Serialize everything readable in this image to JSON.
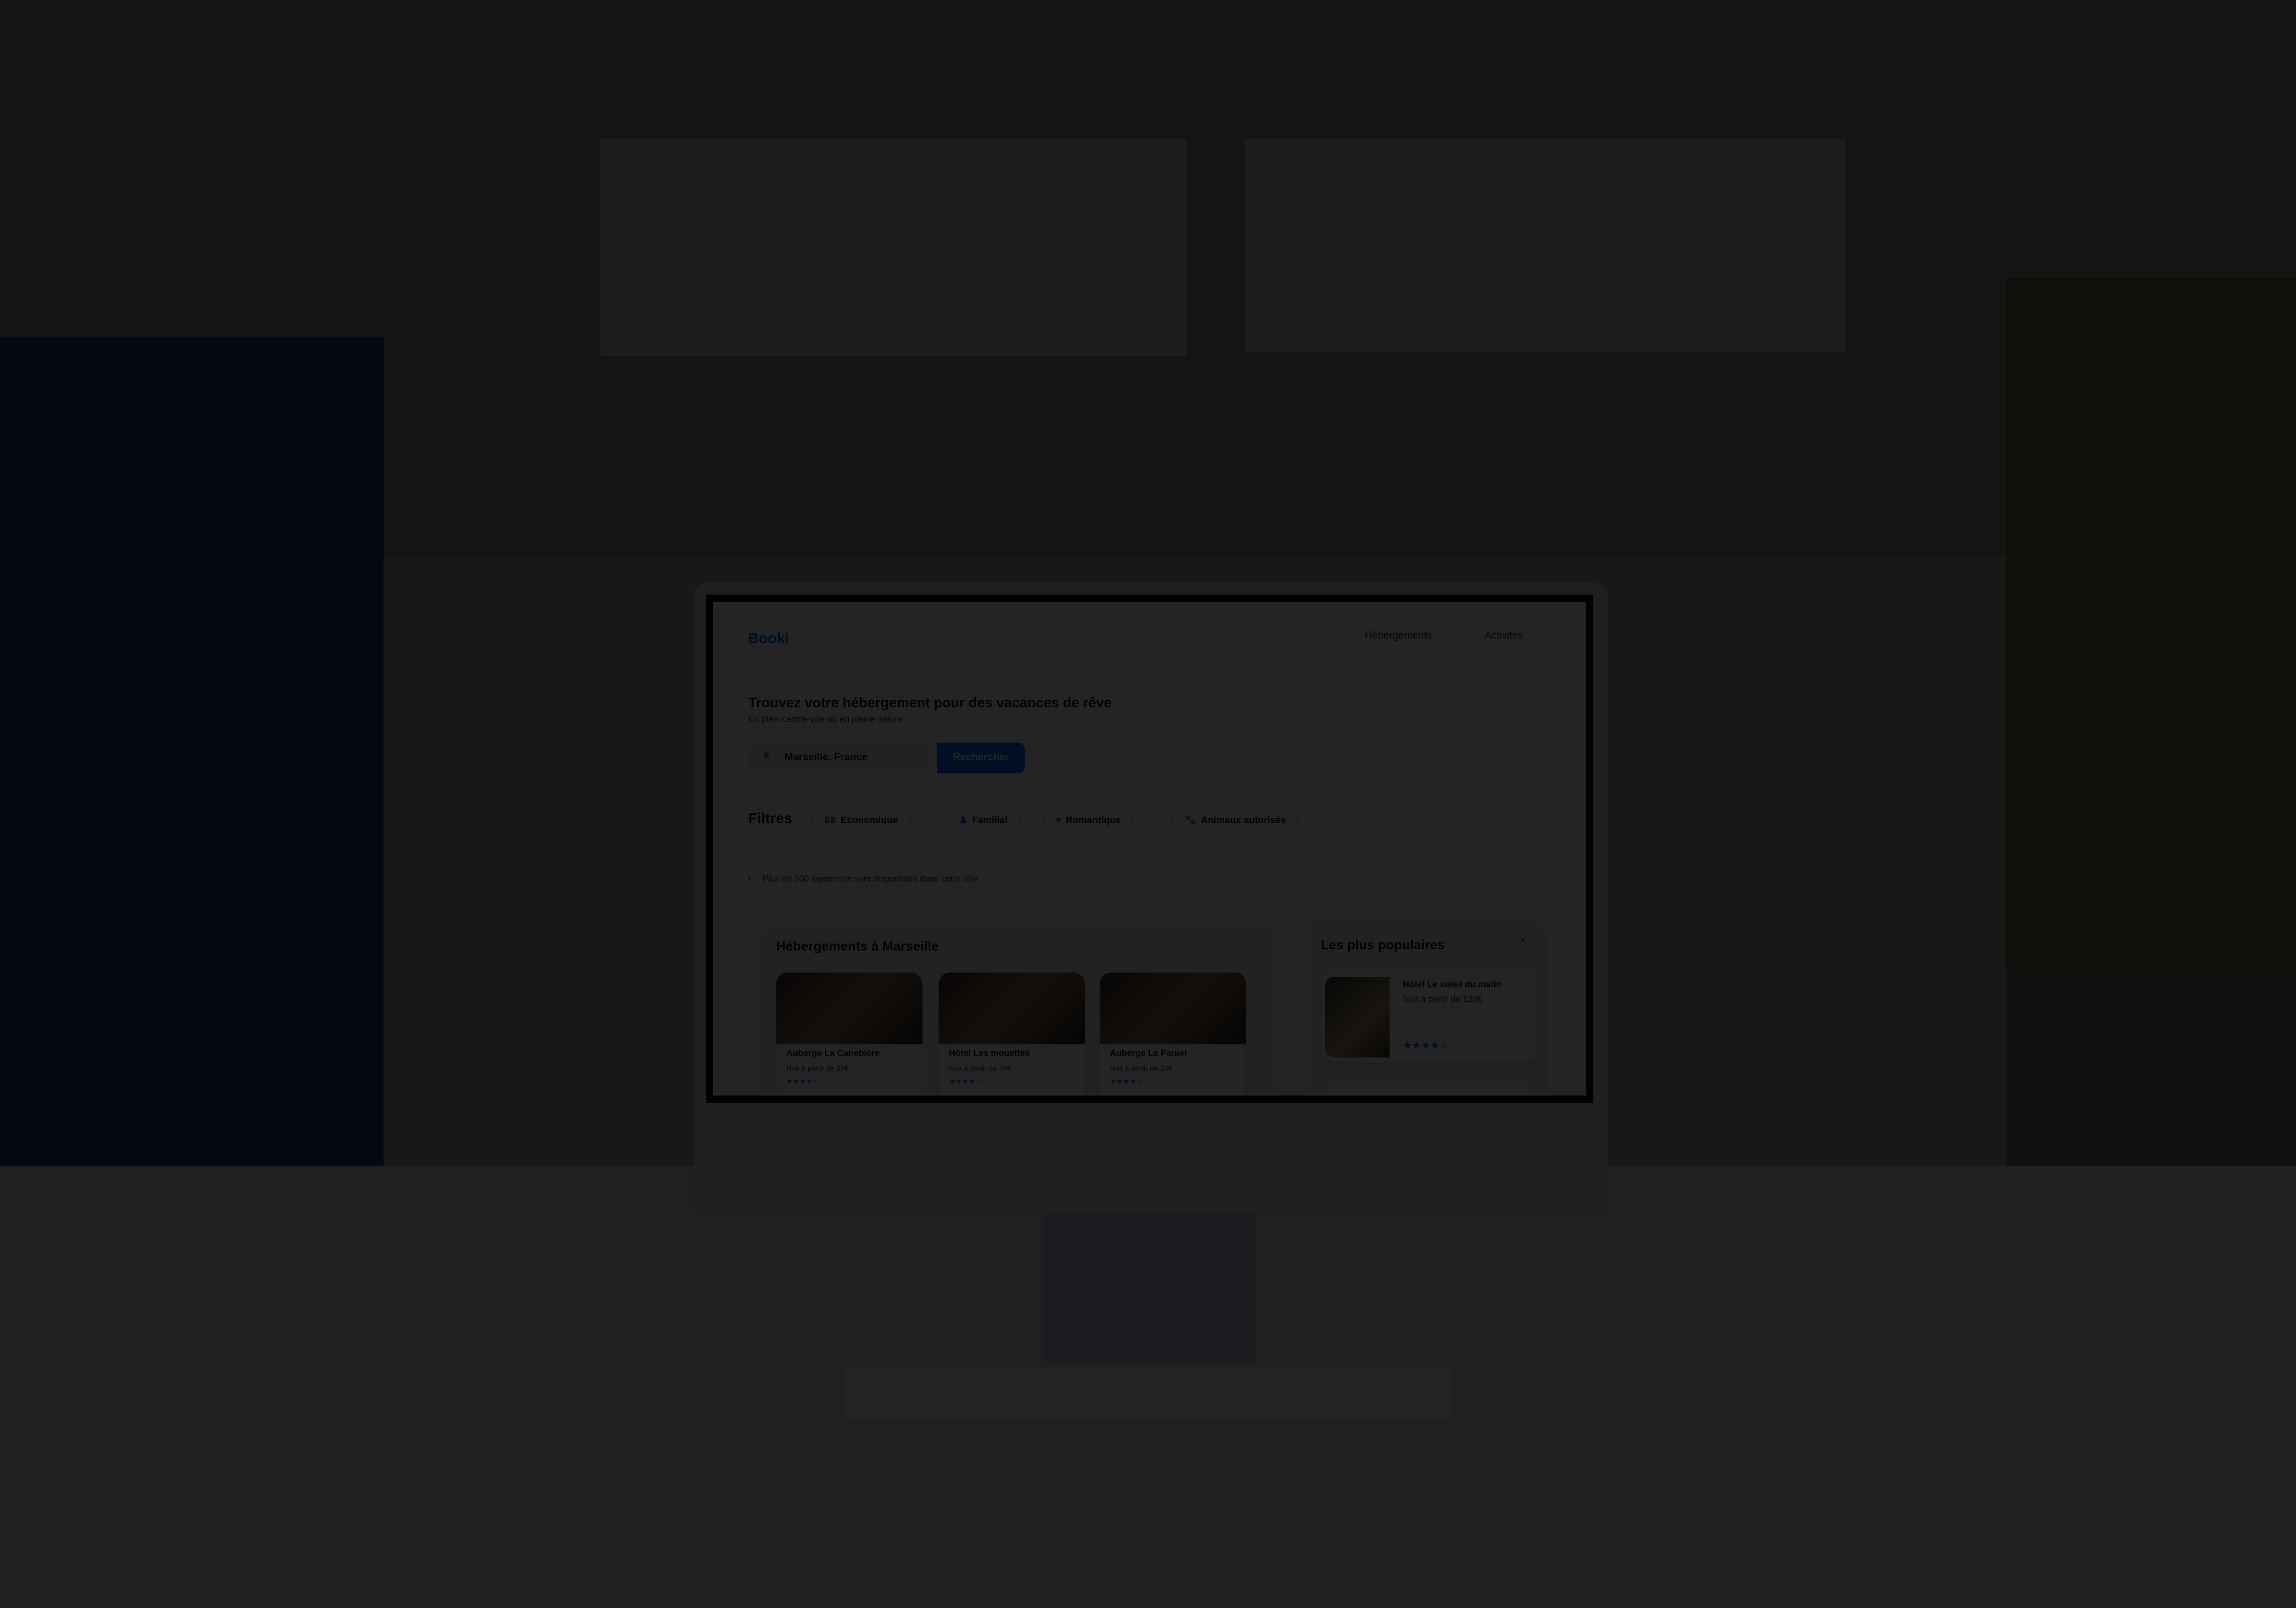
{
  "site": {
    "logo": "Booki",
    "nav": [
      "Hébergements",
      "Activités"
    ],
    "headline": "Trouvez votre hébergement pour des vacances de rêve",
    "subtitle": "En plein centre-ville ou en pleine nature",
    "search": {
      "value": "Marseille, France",
      "icon": "map-pin-icon",
      "button": "Rechercher"
    },
    "filters": {
      "label": "Filtres",
      "items": [
        {
          "label": "Économique",
          "icon": "money-icon"
        },
        {
          "label": "Familial",
          "icon": "child-icon"
        },
        {
          "label": "Romantique",
          "icon": "heart-icon"
        },
        {
          "label": "Animaux autorisés",
          "icon": "dog-icon"
        }
      ]
    },
    "info": "Plus de 500 logements sont disponibles dans cette ville",
    "listing": {
      "title": "Hébergements à Marseille",
      "cards": [
        {
          "name": "Auberge La Canebière",
          "price": "Nuit à partir de 25€",
          "stars": "★★★★☆"
        },
        {
          "name": "Hôtel Les mouettes",
          "price": "Nuit à partir de 76€",
          "stars": "★★★★☆"
        },
        {
          "name": "Auberge Le Panier",
          "price": "Nuit à partir de 23€",
          "stars": "★★★★☆"
        }
      ]
    },
    "popular": {
      "title": "Les plus populaires",
      "icon": "trend-icon",
      "cards": [
        {
          "name": "Hôtel Le soleil du matin",
          "price": "Nuit à partir de 128€",
          "stars": "★★★★☆"
        }
      ]
    }
  }
}
